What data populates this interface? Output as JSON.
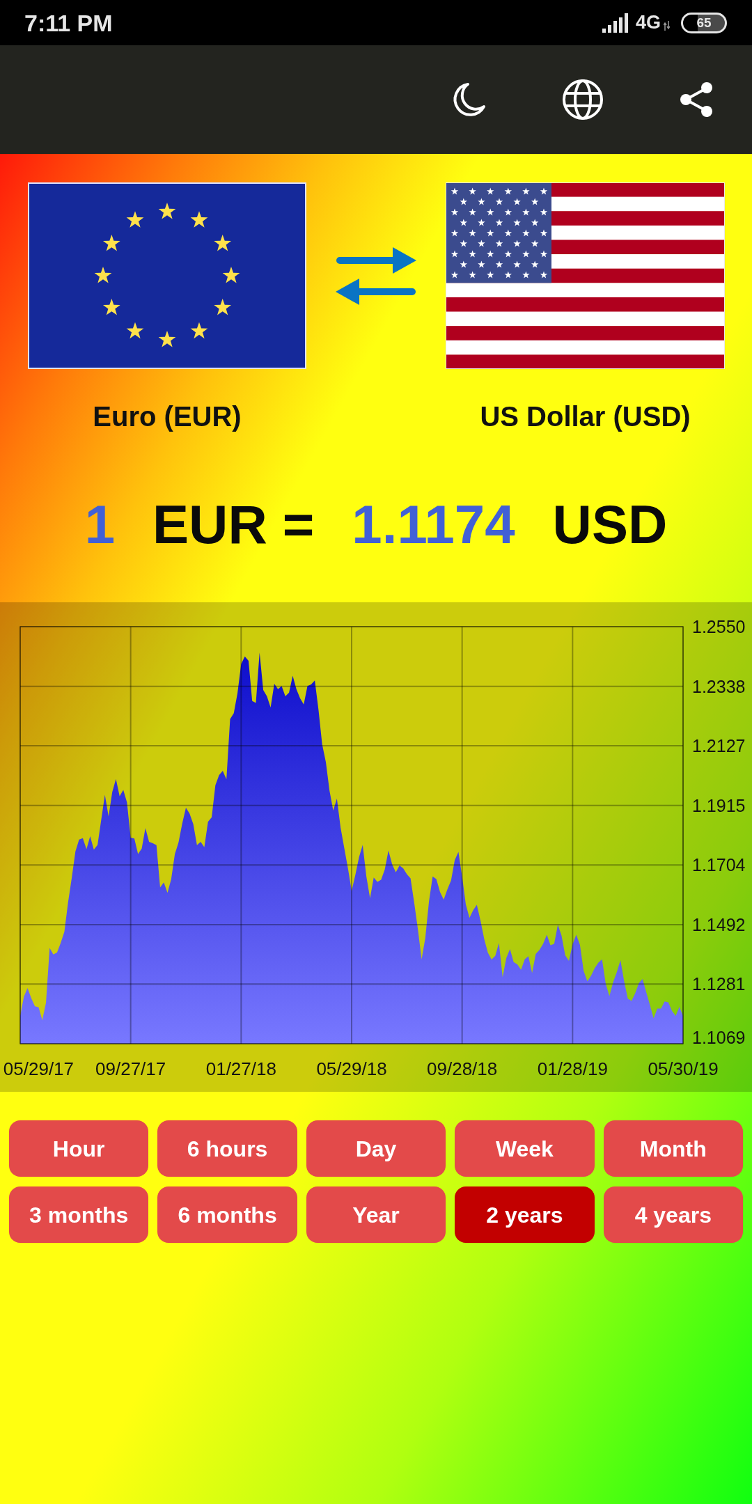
{
  "status_bar": {
    "time": "7:11 PM",
    "network": "4G",
    "battery": "65"
  },
  "currencies": [
    {
      "name": "Euro (EUR)"
    },
    {
      "name": "US Dollar (USD)"
    }
  ],
  "rate": {
    "amount": "1",
    "from_code": "EUR",
    "equals": "=",
    "value": "1.1174",
    "to_code": "USD"
  },
  "chart": {
    "chart_data": {
      "type": "area",
      "grid": true,
      "categories": [
        null,
        null,
        null,
        null,
        null,
        "05/29/17",
        null,
        null,
        null,
        null,
        null,
        null,
        null,
        null,
        null,
        null,
        null,
        null,
        null,
        null,
        null,
        null,
        null,
        null,
        null,
        null,
        null,
        null,
        null,
        null,
        "09/27/17",
        null,
        null,
        null,
        null,
        null,
        null,
        null,
        null,
        null,
        null,
        null,
        null,
        null,
        null,
        null,
        null,
        null,
        null,
        null,
        null,
        null,
        null,
        null,
        null,
        null,
        null,
        null,
        null,
        null,
        "01/27/18",
        null,
        null,
        null,
        null,
        null,
        null,
        null,
        null,
        null,
        null,
        null,
        null,
        null,
        null,
        null,
        null,
        null,
        null,
        null,
        null,
        null,
        null,
        null,
        null,
        null,
        null,
        null,
        null,
        null,
        "05/29/18",
        null,
        null,
        null,
        null,
        null,
        null,
        null,
        null,
        null,
        null,
        null,
        null,
        null,
        null,
        null,
        null,
        null,
        null,
        null,
        null,
        null,
        null,
        null,
        null,
        null,
        null,
        null,
        null,
        null,
        "09/28/18",
        null,
        null,
        null,
        null,
        null,
        null,
        null,
        null,
        null,
        null,
        null,
        null,
        null,
        null,
        null,
        null,
        null,
        null,
        null,
        null,
        null,
        null,
        null,
        null,
        null,
        null,
        null,
        null,
        null,
        "01/28/19",
        null,
        null,
        null,
        null,
        null,
        null,
        null,
        null,
        null,
        null,
        null,
        null,
        null,
        null,
        null,
        null,
        null,
        null,
        null,
        null,
        null,
        null,
        null,
        null,
        null,
        null,
        null,
        null,
        null,
        "05/30/19"
      ],
      "values": [
        1.1168,
        1.1236,
        1.1267,
        1.1231,
        1.1202,
        1.1199,
        1.1153,
        1.1214,
        1.1409,
        1.1386,
        1.1393,
        1.1427,
        1.1467,
        1.1571,
        1.1658,
        1.1752,
        1.1794,
        1.1799,
        1.176,
        1.1806,
        1.1758,
        1.1775,
        1.1864,
        1.1953,
        1.1876,
        1.1963,
        1.2009,
        1.1948,
        1.197,
        1.1926,
        1.1801,
        1.1798,
        1.1743,
        1.1762,
        1.1835,
        1.1786,
        1.1781,
        1.1774,
        1.1624,
        1.1642,
        1.1605,
        1.1653,
        1.1743,
        1.1784,
        1.1851,
        1.1907,
        1.1886,
        1.1849,
        1.1774,
        1.1786,
        1.1767,
        1.1857,
        1.1873,
        1.1987,
        1.2023,
        1.2038,
        1.2008,
        1.2222,
        1.2243,
        1.2313,
        1.2417,
        1.2444,
        1.2429,
        1.2286,
        1.2279,
        1.2458,
        1.2325,
        1.2303,
        1.2263,
        1.2347,
        1.2328,
        1.2339,
        1.2303,
        1.2316,
        1.2376,
        1.2328,
        1.2296,
        1.2274,
        1.2339,
        1.2345,
        1.2359,
        1.2255,
        1.2132,
        1.2069,
        1.1967,
        1.1897,
        1.1939,
        1.1837,
        1.1764,
        1.1692,
        1.1612,
        1.1668,
        1.1731,
        1.1775,
        1.1663,
        1.1586,
        1.1659,
        1.1644,
        1.1651,
        1.1688,
        1.1755,
        1.1706,
        1.1678,
        1.1702,
        1.1692,
        1.1671,
        1.1656,
        1.1569,
        1.1475,
        1.1369,
        1.1444,
        1.1574,
        1.1663,
        1.1654,
        1.1608,
        1.1581,
        1.1617,
        1.1649,
        1.1721,
        1.175,
        1.1663,
        1.1564,
        1.1516,
        1.1543,
        1.1562,
        1.1506,
        1.1441,
        1.1392,
        1.1368,
        1.1381,
        1.1427,
        1.1305,
        1.1373,
        1.1405,
        1.1359,
        1.1351,
        1.1332,
        1.1369,
        1.138,
        1.132,
        1.1388,
        1.1402,
        1.1424,
        1.1456,
        1.1419,
        1.1424,
        1.1492,
        1.1453,
        1.1383,
        1.1363,
        1.1422,
        1.1456,
        1.142,
        1.1328,
        1.1291,
        1.131,
        1.1337,
        1.1357,
        1.1369,
        1.1282,
        1.1238,
        1.1287,
        1.1323,
        1.1366,
        1.1291,
        1.1229,
        1.1221,
        1.1248,
        1.1284,
        1.1299,
        1.1252,
        1.1207,
        1.1159,
        1.1194,
        1.1194,
        1.1219,
        1.1216,
        1.1185,
        1.1168,
        1.12,
        1.1168
      ],
      "ylim": [
        1.1069,
        1.255
      ],
      "yticks": [
        {
          "value": 1.255,
          "label": "1.2550"
        },
        {
          "value": 1.2338,
          "label": "1.2338"
        },
        {
          "value": 1.2127,
          "label": "1.2127"
        },
        {
          "value": 1.1915,
          "label": "1.1915"
        },
        {
          "value": 1.1704,
          "label": "1.1704"
        },
        {
          "value": 1.1492,
          "label": "1.1492"
        },
        {
          "value": 1.1281,
          "label": "1.1281"
        },
        {
          "value": 1.1069,
          "label": "1.1069"
        }
      ]
    }
  },
  "periods": [
    {
      "label": "Hour",
      "selected": false
    },
    {
      "label": "6 hours",
      "selected": false
    },
    {
      "label": "Day",
      "selected": false
    },
    {
      "label": "Week",
      "selected": false
    },
    {
      "label": "Month",
      "selected": false
    },
    {
      "label": "3 months",
      "selected": false
    },
    {
      "label": "6 months",
      "selected": false
    },
    {
      "label": "Year",
      "selected": false
    },
    {
      "label": "2 years",
      "selected": true
    },
    {
      "label": "4 years",
      "selected": false
    }
  ]
}
